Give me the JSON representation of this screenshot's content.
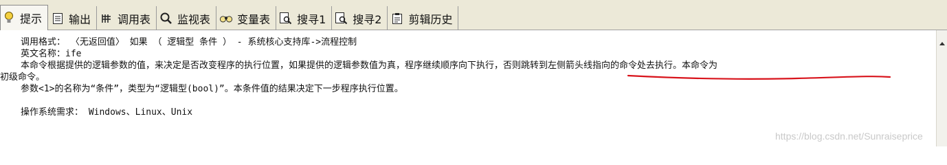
{
  "tabs": [
    {
      "label": "提示",
      "icon": "lightbulb-icon",
      "active": true
    },
    {
      "label": "输出",
      "icon": "document-icon"
    },
    {
      "label": "调用表",
      "icon": "stack-icon"
    },
    {
      "label": "监视表",
      "icon": "magnifier-icon"
    },
    {
      "label": "变量表",
      "icon": "binoculars-icon"
    },
    {
      "label": "搜寻1",
      "icon": "search-document-icon"
    },
    {
      "label": "搜寻2",
      "icon": "search-document-icon"
    },
    {
      "label": "剪辑历史",
      "icon": "clipboard-icon"
    }
  ],
  "content": {
    "call_format": "调用格式：  〈无返回值〉 如果 （ 逻辑型 条件 ） - 系统核心支持库->流程控制",
    "english_name": "英文名称：ife",
    "description_line1": "本命令根据提供的逻辑参数的值，来决定是否改变程序的执行位置，如果提供的逻辑参数值为真，程序继续顺序向下执行，否则跳转到左侧箭头线指向的命令处去执行。本命令为",
    "description_line2": "初级命令。",
    "param_line": "参数<1>的名称为“条件”，类型为“逻辑型(bool)”。本条件值的结果决定下一步程序执行位置。",
    "os_requirement": "操作系统需求： Windows、Linux、Unix"
  },
  "watermark": "https://blog.csdn.net/Sunraiseprice",
  "colors": {
    "annotation": "#d8121a",
    "tab_bar": "#ece9d8"
  }
}
